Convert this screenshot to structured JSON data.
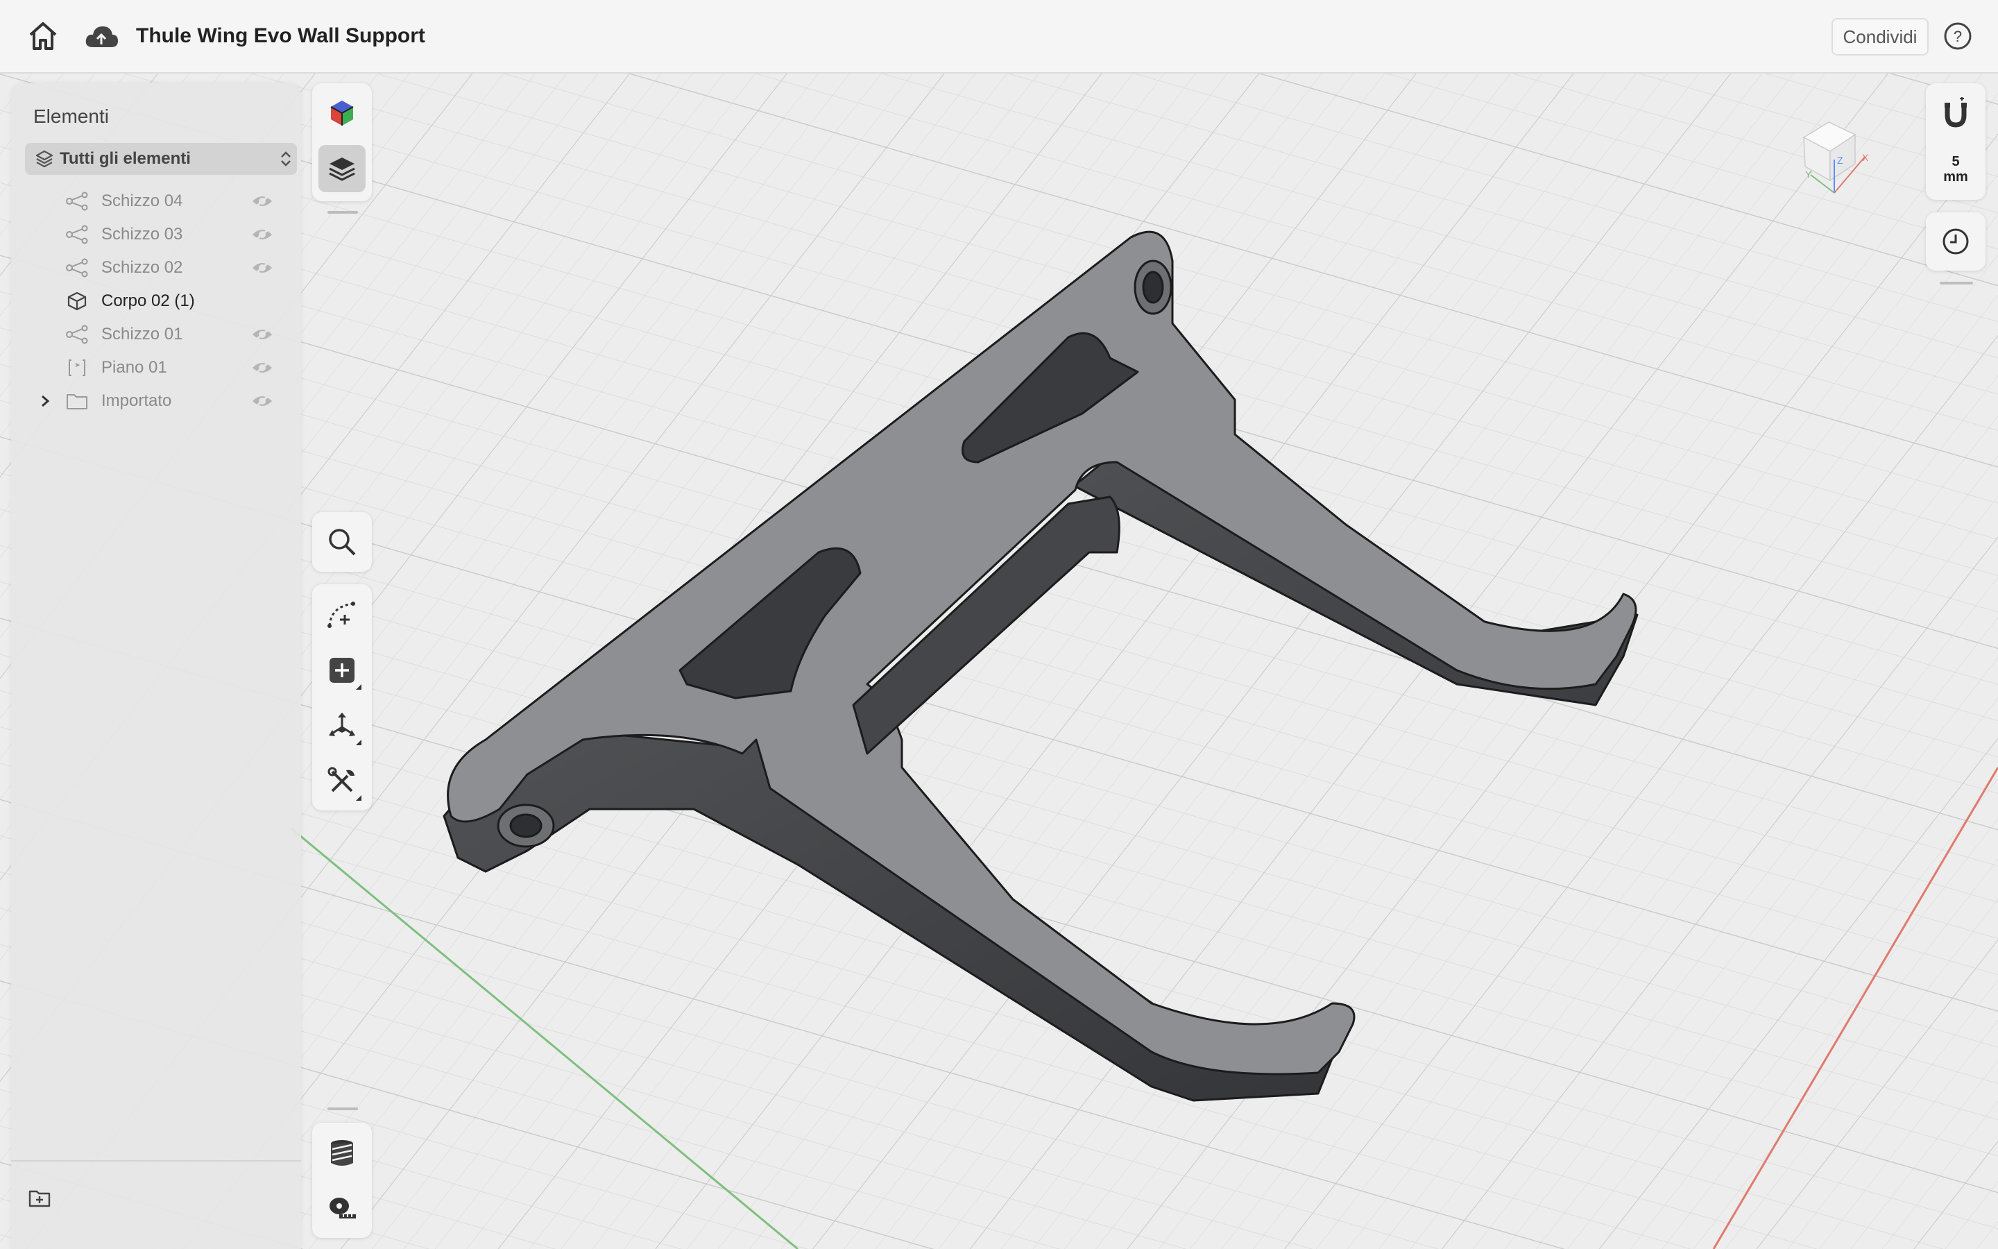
{
  "titlebar": {
    "home_icon": "home-icon",
    "cloud_icon": "cloud-sync-icon",
    "document_title": "Thule Wing Evo Wall Support",
    "share_label": "Condividi",
    "help_icon": "help-icon"
  },
  "sidebar": {
    "heading": "Elementi",
    "filter": {
      "label": "Tutti gli elementi",
      "icon": "layers-icon"
    },
    "items": [
      {
        "label": "Schizzo 04",
        "icon": "sketch-icon",
        "visible_toggle": true
      },
      {
        "label": "Schizzo 03",
        "icon": "sketch-icon",
        "visible_toggle": true
      },
      {
        "label": "Schizzo 02",
        "icon": "sketch-icon",
        "visible_toggle": true
      },
      {
        "label": "Corpo 02 (1)",
        "icon": "body-cube-icon",
        "visible_toggle": false,
        "active": true
      },
      {
        "label": "Schizzo 01",
        "icon": "sketch-icon",
        "visible_toggle": true
      },
      {
        "label": "Piano 01",
        "icon": "plane-icon",
        "visible_toggle": true
      },
      {
        "label": "Importato",
        "icon": "folder-icon",
        "visible_toggle": true,
        "expandable": true
      }
    ],
    "footer_icon": "new-folder-icon"
  },
  "left_tools": {
    "top": [
      "appearance-cube-icon",
      "layers-stack-icon"
    ],
    "middle": [
      "search-icon",
      "sketch-tool-icon",
      "add-primitive-icon",
      "transform-icon",
      "tools-icon"
    ],
    "bottom": [
      "section-view-icon",
      "measure-tape-icon"
    ]
  },
  "right_tools": {
    "snap_icon": "magnet-icon",
    "grid_scale_value": "5",
    "grid_scale_unit": "mm",
    "history_icon": "history-clock-icon"
  },
  "colors": {
    "accent": "#4a9a4a",
    "model": "#8e8f92",
    "grid": "#d9d9d9"
  }
}
